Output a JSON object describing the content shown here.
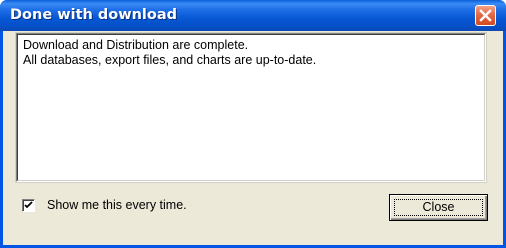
{
  "window": {
    "title": "Done with download"
  },
  "message": {
    "lines": [
      "Download and Distribution are complete.",
      "All databases, export files, and charts are up-to-date."
    ]
  },
  "checkbox": {
    "label": "Show me this every time.",
    "checked": true
  },
  "buttons": {
    "close_label": "Close"
  },
  "icons": {
    "title_close": "close-icon",
    "checkbox_mark": "checkmark-icon"
  },
  "colors": {
    "titlebar": "#0757d4",
    "close_button_red": "#e36a45",
    "dialog_face": "#ece9d8"
  }
}
